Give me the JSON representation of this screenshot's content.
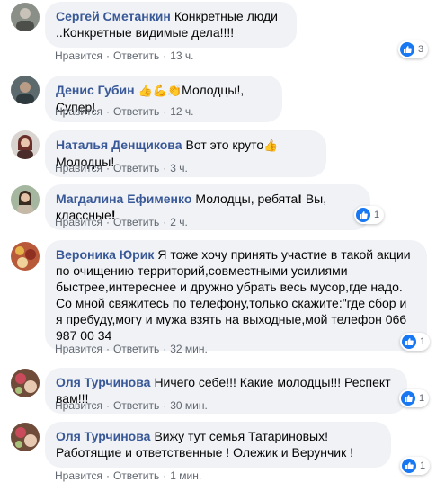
{
  "comments": [
    {
      "author": "Сергей Сметанкин",
      "text": "Конкретные люди ..Конкретные видимые дела!!!!",
      "like": "Нравится",
      "reply": "Ответить",
      "time": "13 ч.",
      "reactions": "3"
    },
    {
      "author": "Денис Губин",
      "text_emojis": "👍💪👏",
      "text": "Молодцы!, Супер!",
      "like": "Нравится",
      "reply": "Ответить",
      "time": "12 ч."
    },
    {
      "author": "Наталья Денщикова",
      "text": "Вот это круто",
      "text_emoji": "👍",
      "text_after": " Молодцы!",
      "like": "Нравится",
      "reply": "Ответить",
      "time": "3 ч."
    },
    {
      "author": "Магдалина Ефименко",
      "text_part1": "Молодцы, ребята",
      "mark1": "!",
      "text_part2": " Вы, классные",
      "mark2": "!",
      "like": "Нравится",
      "reply": "Ответить",
      "time": "2 ч.",
      "reactions": "1"
    },
    {
      "author": "Вероника Юрик",
      "text": "Я тоже хочу принять участие в такой акции по очищению территорий,совместными усилиями быстрее,интереснее и дружно убрать весь мусор,где надо. Со мной свяжитесь по телефону,только скажите:\"где сбор и я пребуду,могу и мужа взять на выходные,мой телефон 066 987 00 34",
      "like": "Нравится",
      "reply": "Ответить",
      "time": "32 мин.",
      "reactions": "1"
    },
    {
      "author": "Оля Турчинова",
      "text": "Ничего себе!!! Какие молодцы!!! Респект вам!!!",
      "like": "Нравится",
      "reply": "Ответить",
      "time": "30 мин.",
      "reactions": "1"
    },
    {
      "author": "Оля Турчинова",
      "text": "Вижу тут семья Татариновых! Работящие и ответственные ! Олежик и Верунчик !",
      "like": "Нравится",
      "reply": "Ответить",
      "time": "1 мин.",
      "reactions": "1"
    }
  ],
  "separator": "·",
  "colors": {
    "author": "#385898",
    "bubble": "#f0f2f5",
    "like_blue": "#1877f2",
    "meta": "#606770"
  }
}
